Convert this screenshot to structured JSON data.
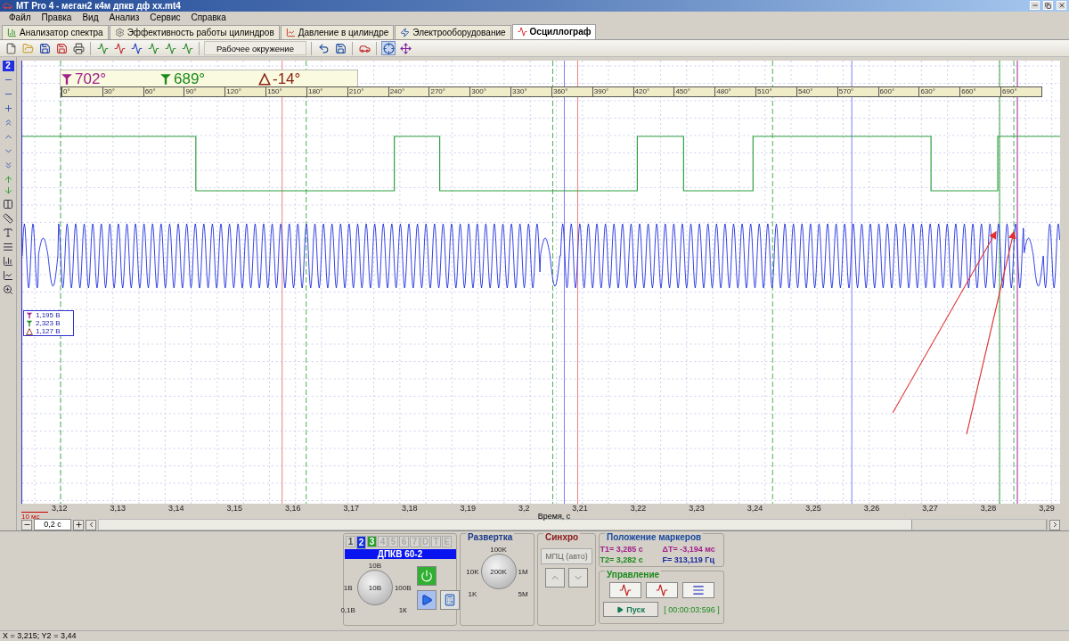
{
  "window": {
    "title": "MT Pro 4 - меган2 к4м дпкв дф хх.mt4"
  },
  "menu": [
    "Файл",
    "Правка",
    "Вид",
    "Анализ",
    "Сервис",
    "Справка"
  ],
  "tabs": [
    {
      "label": "Анализатор спектра",
      "selected": false
    },
    {
      "label": "Эффективность работы цилиндров",
      "selected": false
    },
    {
      "label": "Давление в цилиндре",
      "selected": false
    },
    {
      "label": "Электрооборудование",
      "selected": false
    },
    {
      "label": "Осциллограф",
      "selected": true
    }
  ],
  "toolbar": {
    "workspace": "Рабочее окружение"
  },
  "left_toolbar": {
    "channel": "2"
  },
  "plot": {
    "markers": [
      {
        "kind": "t1",
        "value": "702°"
      },
      {
        "kind": "t2",
        "value": "689°"
      },
      {
        "kind": "delta",
        "value": "-14°"
      }
    ],
    "angle_ticks": [
      "0°",
      "30°",
      "60°",
      "90°",
      "120°",
      "150°",
      "180°",
      "210°",
      "240°",
      "270°",
      "300°",
      "330°",
      "360°",
      "390°",
      "420°",
      "450°",
      "480°",
      "510°",
      "540°",
      "570°",
      "600°",
      "630°",
      "660°",
      "690°"
    ],
    "readings": [
      {
        "kind": "t1",
        "text": "1,195 В"
      },
      {
        "kind": "t2",
        "text": "2,323 В"
      },
      {
        "kind": "delta",
        "text": "1,127 В"
      }
    ],
    "time_ticks": [
      "3,12",
      "3,13",
      "3,14",
      "3,15",
      "3,16",
      "3,17",
      "3,18",
      "3,19",
      "3,2",
      "3,21",
      "3,22",
      "3,23",
      "3,24",
      "3,25",
      "3,26",
      "3,27",
      "3,28",
      "3,29"
    ],
    "xlabel": "Время, с",
    "scale": "10 мс"
  },
  "scroll": {
    "zoom": "0,2 с"
  },
  "channel_panel": {
    "tabs": [
      {
        "label": "1",
        "selected": false,
        "active": false,
        "disabled": false
      },
      {
        "label": "2",
        "selected": true,
        "active": false,
        "disabled": false
      },
      {
        "label": "3",
        "selected": false,
        "active": true,
        "disabled": false
      },
      {
        "label": "4",
        "selected": false,
        "active": false,
        "disabled": true
      },
      {
        "label": "5",
        "selected": false,
        "active": false,
        "disabled": true
      },
      {
        "label": "6",
        "selected": false,
        "active": false,
        "disabled": true
      },
      {
        "label": "7",
        "selected": false,
        "active": false,
        "disabled": true
      },
      {
        "label": "D",
        "selected": false,
        "active": false,
        "disabled": true
      },
      {
        "label": "T",
        "selected": false,
        "active": false,
        "disabled": true
      },
      {
        "label": "E",
        "selected": false,
        "active": false,
        "disabled": true
      }
    ],
    "name": "ДПКВ 60-2",
    "knob": {
      "top": "10В",
      "left": "1В",
      "right": "100В",
      "bottom_left": "0,1В",
      "bottom_right": "1К",
      "center": "10В"
    }
  },
  "sweep": {
    "title": "Развертка",
    "knob": {
      "top": "100K",
      "left": "10K",
      "right": "1M",
      "bottom_left": "1K",
      "bottom_right": "5M",
      "center": "200K"
    }
  },
  "sync": {
    "title": "Синхро",
    "mode": "МПЦ (авто)"
  },
  "marker_positions": {
    "title": "Положение маркеров",
    "values": [
      {
        "text": "T1= 3,285 с",
        "color": "#a0208a"
      },
      {
        "text": "ΔT= -3,194 мс",
        "color": "#a0208a"
      },
      {
        "text": "T2= 3,282 с",
        "color": "#1a8a1a"
      },
      {
        "text": "F= 313,119 Гц",
        "color": "#1a2a9a"
      }
    ]
  },
  "control": {
    "title": "Управление",
    "start": "Пуск",
    "timer": "[ 00:00:03:596 ]"
  },
  "status_bar": "X = 3,215; Y2 = 3,44"
}
